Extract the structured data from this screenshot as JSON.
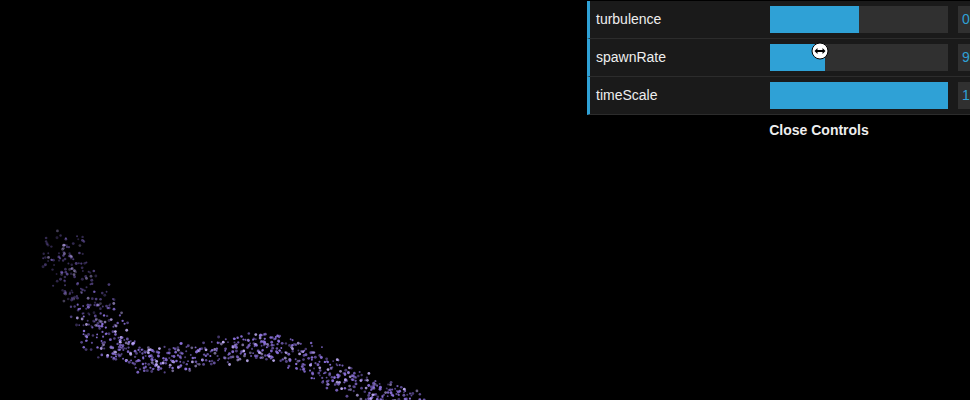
{
  "controls": {
    "rows": [
      {
        "label": "turbulence",
        "level": 0.5,
        "value": "0"
      },
      {
        "label": "spawnRate",
        "level": 0.31,
        "value": "9"
      },
      {
        "label": "timeScale",
        "level": 1.0,
        "value": "1"
      }
    ],
    "close_button": "Close Controls"
  }
}
